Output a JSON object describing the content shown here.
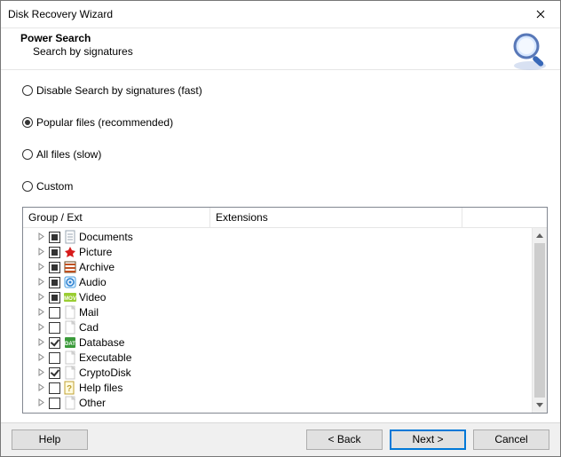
{
  "titlebar": {
    "title": "Disk Recovery Wizard"
  },
  "header": {
    "title": "Power Search",
    "subtitle": "Search by signatures"
  },
  "radios": {
    "r0": {
      "label": "Disable Search by signatures (fast)",
      "selected": false
    },
    "r1": {
      "label": "Popular files (recommended)",
      "selected": true
    },
    "r2": {
      "label": "All files (slow)",
      "selected": false
    },
    "r3": {
      "label": "Custom",
      "selected": false
    }
  },
  "columns": {
    "group": "Group / Ext",
    "ext": "Extensions",
    "last": ""
  },
  "tree": [
    {
      "label": "Documents",
      "check": "filled",
      "icon": "doc"
    },
    {
      "label": "Picture",
      "check": "filled",
      "icon": "pic"
    },
    {
      "label": "Archive",
      "check": "filled",
      "icon": "arc"
    },
    {
      "label": "Audio",
      "check": "filled",
      "icon": "aud"
    },
    {
      "label": "Video",
      "check": "filled",
      "icon": "vid"
    },
    {
      "label": "Mail",
      "check": "empty",
      "icon": "blank"
    },
    {
      "label": "Cad",
      "check": "empty",
      "icon": "blank"
    },
    {
      "label": "Database",
      "check": "check",
      "icon": "db"
    },
    {
      "label": "Executable",
      "check": "empty",
      "icon": "blank"
    },
    {
      "label": "CryptoDisk",
      "check": "check",
      "icon": "blank"
    },
    {
      "label": "Help files",
      "check": "empty",
      "icon": "help"
    },
    {
      "label": "Other",
      "check": "empty",
      "icon": "blank"
    }
  ],
  "buttons": {
    "help": "Help",
    "back": "< Back",
    "next": "Next >",
    "cancel": "Cancel"
  }
}
